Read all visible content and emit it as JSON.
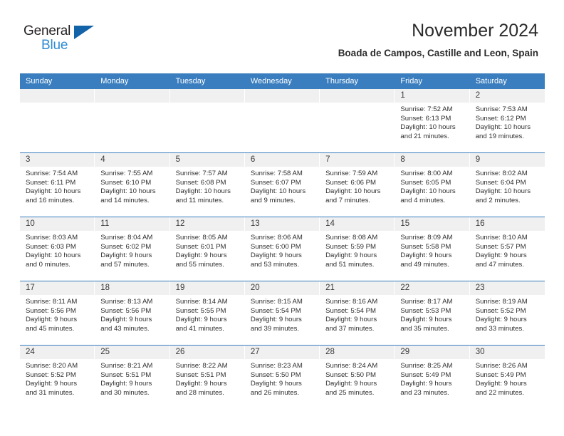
{
  "logo": {
    "word_top": "General",
    "word_bottom": "Blue",
    "triangle_color": "#1263a8",
    "blue_text_color": "#2e8bd4"
  },
  "header": {
    "title": "November 2024",
    "subtitle": "Boada de Campos, Castille and Leon, Spain"
  },
  "theme": {
    "header_blue": "#3a7ebf",
    "daynum_band": "#f0f0f0",
    "text": "#2f2f2f"
  },
  "weekday_headers": [
    "Sunday",
    "Monday",
    "Tuesday",
    "Wednesday",
    "Thursday",
    "Friday",
    "Saturday"
  ],
  "weeks": [
    [
      {
        "day": "",
        "sunrise": "",
        "sunset": "",
        "daylight_line1": "",
        "daylight_line2": ""
      },
      {
        "day": "",
        "sunrise": "",
        "sunset": "",
        "daylight_line1": "",
        "daylight_line2": ""
      },
      {
        "day": "",
        "sunrise": "",
        "sunset": "",
        "daylight_line1": "",
        "daylight_line2": ""
      },
      {
        "day": "",
        "sunrise": "",
        "sunset": "",
        "daylight_line1": "",
        "daylight_line2": ""
      },
      {
        "day": "",
        "sunrise": "",
        "sunset": "",
        "daylight_line1": "",
        "daylight_line2": ""
      },
      {
        "day": "1",
        "sunrise": "Sunrise: 7:52 AM",
        "sunset": "Sunset: 6:13 PM",
        "daylight_line1": "Daylight: 10 hours",
        "daylight_line2": "and 21 minutes."
      },
      {
        "day": "2",
        "sunrise": "Sunrise: 7:53 AM",
        "sunset": "Sunset: 6:12 PM",
        "daylight_line1": "Daylight: 10 hours",
        "daylight_line2": "and 19 minutes."
      }
    ],
    [
      {
        "day": "3",
        "sunrise": "Sunrise: 7:54 AM",
        "sunset": "Sunset: 6:11 PM",
        "daylight_line1": "Daylight: 10 hours",
        "daylight_line2": "and 16 minutes."
      },
      {
        "day": "4",
        "sunrise": "Sunrise: 7:55 AM",
        "sunset": "Sunset: 6:10 PM",
        "daylight_line1": "Daylight: 10 hours",
        "daylight_line2": "and 14 minutes."
      },
      {
        "day": "5",
        "sunrise": "Sunrise: 7:57 AM",
        "sunset": "Sunset: 6:08 PM",
        "daylight_line1": "Daylight: 10 hours",
        "daylight_line2": "and 11 minutes."
      },
      {
        "day": "6",
        "sunrise": "Sunrise: 7:58 AM",
        "sunset": "Sunset: 6:07 PM",
        "daylight_line1": "Daylight: 10 hours",
        "daylight_line2": "and 9 minutes."
      },
      {
        "day": "7",
        "sunrise": "Sunrise: 7:59 AM",
        "sunset": "Sunset: 6:06 PM",
        "daylight_line1": "Daylight: 10 hours",
        "daylight_line2": "and 7 minutes."
      },
      {
        "day": "8",
        "sunrise": "Sunrise: 8:00 AM",
        "sunset": "Sunset: 6:05 PM",
        "daylight_line1": "Daylight: 10 hours",
        "daylight_line2": "and 4 minutes."
      },
      {
        "day": "9",
        "sunrise": "Sunrise: 8:02 AM",
        "sunset": "Sunset: 6:04 PM",
        "daylight_line1": "Daylight: 10 hours",
        "daylight_line2": "and 2 minutes."
      }
    ],
    [
      {
        "day": "10",
        "sunrise": "Sunrise: 8:03 AM",
        "sunset": "Sunset: 6:03 PM",
        "daylight_line1": "Daylight: 10 hours",
        "daylight_line2": "and 0 minutes."
      },
      {
        "day": "11",
        "sunrise": "Sunrise: 8:04 AM",
        "sunset": "Sunset: 6:02 PM",
        "daylight_line1": "Daylight: 9 hours",
        "daylight_line2": "and 57 minutes."
      },
      {
        "day": "12",
        "sunrise": "Sunrise: 8:05 AM",
        "sunset": "Sunset: 6:01 PM",
        "daylight_line1": "Daylight: 9 hours",
        "daylight_line2": "and 55 minutes."
      },
      {
        "day": "13",
        "sunrise": "Sunrise: 8:06 AM",
        "sunset": "Sunset: 6:00 PM",
        "daylight_line1": "Daylight: 9 hours",
        "daylight_line2": "and 53 minutes."
      },
      {
        "day": "14",
        "sunrise": "Sunrise: 8:08 AM",
        "sunset": "Sunset: 5:59 PM",
        "daylight_line1": "Daylight: 9 hours",
        "daylight_line2": "and 51 minutes."
      },
      {
        "day": "15",
        "sunrise": "Sunrise: 8:09 AM",
        "sunset": "Sunset: 5:58 PM",
        "daylight_line1": "Daylight: 9 hours",
        "daylight_line2": "and 49 minutes."
      },
      {
        "day": "16",
        "sunrise": "Sunrise: 8:10 AM",
        "sunset": "Sunset: 5:57 PM",
        "daylight_line1": "Daylight: 9 hours",
        "daylight_line2": "and 47 minutes."
      }
    ],
    [
      {
        "day": "17",
        "sunrise": "Sunrise: 8:11 AM",
        "sunset": "Sunset: 5:56 PM",
        "daylight_line1": "Daylight: 9 hours",
        "daylight_line2": "and 45 minutes."
      },
      {
        "day": "18",
        "sunrise": "Sunrise: 8:13 AM",
        "sunset": "Sunset: 5:56 PM",
        "daylight_line1": "Daylight: 9 hours",
        "daylight_line2": "and 43 minutes."
      },
      {
        "day": "19",
        "sunrise": "Sunrise: 8:14 AM",
        "sunset": "Sunset: 5:55 PM",
        "daylight_line1": "Daylight: 9 hours",
        "daylight_line2": "and 41 minutes."
      },
      {
        "day": "20",
        "sunrise": "Sunrise: 8:15 AM",
        "sunset": "Sunset: 5:54 PM",
        "daylight_line1": "Daylight: 9 hours",
        "daylight_line2": "and 39 minutes."
      },
      {
        "day": "21",
        "sunrise": "Sunrise: 8:16 AM",
        "sunset": "Sunset: 5:54 PM",
        "daylight_line1": "Daylight: 9 hours",
        "daylight_line2": "and 37 minutes."
      },
      {
        "day": "22",
        "sunrise": "Sunrise: 8:17 AM",
        "sunset": "Sunset: 5:53 PM",
        "daylight_line1": "Daylight: 9 hours",
        "daylight_line2": "and 35 minutes."
      },
      {
        "day": "23",
        "sunrise": "Sunrise: 8:19 AM",
        "sunset": "Sunset: 5:52 PM",
        "daylight_line1": "Daylight: 9 hours",
        "daylight_line2": "and 33 minutes."
      }
    ],
    [
      {
        "day": "24",
        "sunrise": "Sunrise: 8:20 AM",
        "sunset": "Sunset: 5:52 PM",
        "daylight_line1": "Daylight: 9 hours",
        "daylight_line2": "and 31 minutes."
      },
      {
        "day": "25",
        "sunrise": "Sunrise: 8:21 AM",
        "sunset": "Sunset: 5:51 PM",
        "daylight_line1": "Daylight: 9 hours",
        "daylight_line2": "and 30 minutes."
      },
      {
        "day": "26",
        "sunrise": "Sunrise: 8:22 AM",
        "sunset": "Sunset: 5:51 PM",
        "daylight_line1": "Daylight: 9 hours",
        "daylight_line2": "and 28 minutes."
      },
      {
        "day": "27",
        "sunrise": "Sunrise: 8:23 AM",
        "sunset": "Sunset: 5:50 PM",
        "daylight_line1": "Daylight: 9 hours",
        "daylight_line2": "and 26 minutes."
      },
      {
        "day": "28",
        "sunrise": "Sunrise: 8:24 AM",
        "sunset": "Sunset: 5:50 PM",
        "daylight_line1": "Daylight: 9 hours",
        "daylight_line2": "and 25 minutes."
      },
      {
        "day": "29",
        "sunrise": "Sunrise: 8:25 AM",
        "sunset": "Sunset: 5:49 PM",
        "daylight_line1": "Daylight: 9 hours",
        "daylight_line2": "and 23 minutes."
      },
      {
        "day": "30",
        "sunrise": "Sunrise: 8:26 AM",
        "sunset": "Sunset: 5:49 PM",
        "daylight_line1": "Daylight: 9 hours",
        "daylight_line2": "and 22 minutes."
      }
    ]
  ]
}
